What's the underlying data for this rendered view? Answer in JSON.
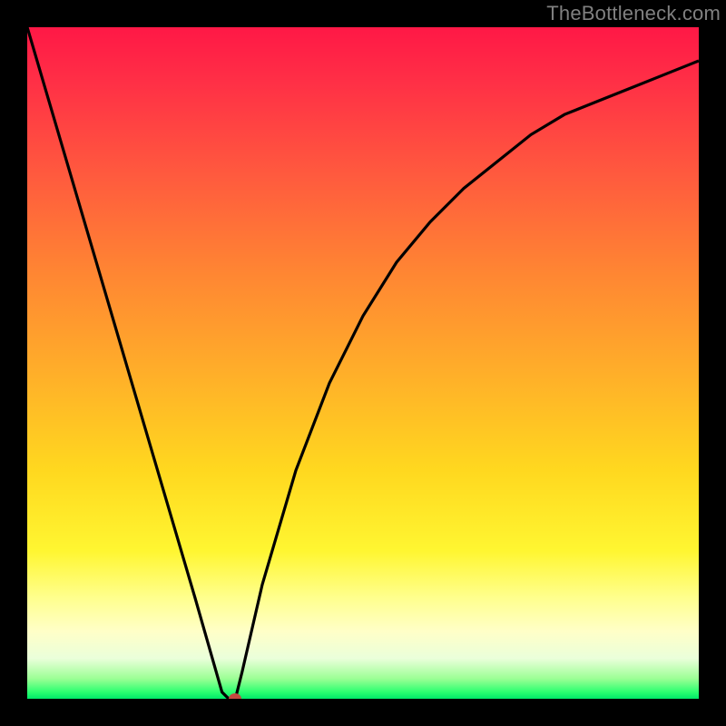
{
  "watermark": "TheBottleneck.com",
  "chart_data": {
    "type": "line",
    "title": "",
    "xlabel": "",
    "ylabel": "",
    "xlim": [
      0,
      100
    ],
    "ylim": [
      0,
      100
    ],
    "x": [
      0,
      5,
      10,
      15,
      20,
      25,
      29,
      30,
      31,
      32,
      35,
      40,
      45,
      50,
      55,
      60,
      65,
      70,
      75,
      80,
      85,
      90,
      95,
      100
    ],
    "y": [
      100,
      83,
      66,
      49,
      32,
      15,
      1,
      0,
      0,
      4,
      17,
      34,
      47,
      57,
      65,
      71,
      76,
      80,
      84,
      87,
      89,
      91,
      93,
      95
    ],
    "marker": {
      "x": 31,
      "y": 0,
      "color": "#c54a3f"
    },
    "annotations": []
  },
  "colors": {
    "frame": "#000000",
    "curve": "#000000",
    "watermark": "#808080"
  }
}
